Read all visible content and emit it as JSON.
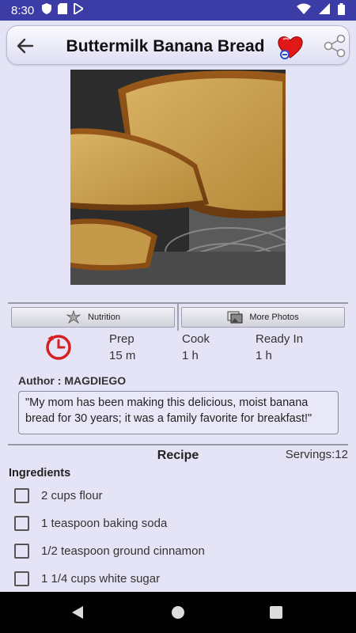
{
  "status_bar": {
    "time": "8:30",
    "icons": [
      "shield-icon",
      "sd-card-icon",
      "play-store-icon",
      "wifi-icon",
      "signal-icon",
      "battery-icon"
    ]
  },
  "app_bar": {
    "title": "Buttermilk Banana Bread",
    "icons": [
      "back-arrow-icon",
      "favorite-heart-icon",
      "share-icon"
    ]
  },
  "photo": {
    "subject": "banana-bread-photo"
  },
  "buttons": {
    "nutrition": "Nutrition",
    "more_photos": "More Photos"
  },
  "timing": {
    "prep_label": "Prep",
    "prep_value": "15 m",
    "cook_label": "Cook",
    "cook_value": "1 h",
    "ready_label": "Ready In",
    "ready_value": "1 h"
  },
  "author": {
    "label": "Author : MAGDIEGO",
    "quote_line1": "\"My mom has been making this delicious, moist banana",
    "quote_line2": "bread for 30 years; it was a family favorite for breakfast!\""
  },
  "recipe": {
    "heading": "Recipe",
    "servings": "Servings:12",
    "ingredients_heading": "Ingredients",
    "ingredients": [
      {
        "label": "2 cups flour",
        "checked": false
      },
      {
        "label": "1 teaspoon baking soda",
        "checked": false
      },
      {
        "label": "1/2 teaspoon ground cinnamon",
        "checked": false
      },
      {
        "label": "1 1/4 cups white sugar",
        "checked": false
      }
    ]
  },
  "colors": {
    "status_bar": "#3c3ca6",
    "background": "#e4e4f6",
    "heart": "#e01818",
    "timer": "#d42020"
  }
}
